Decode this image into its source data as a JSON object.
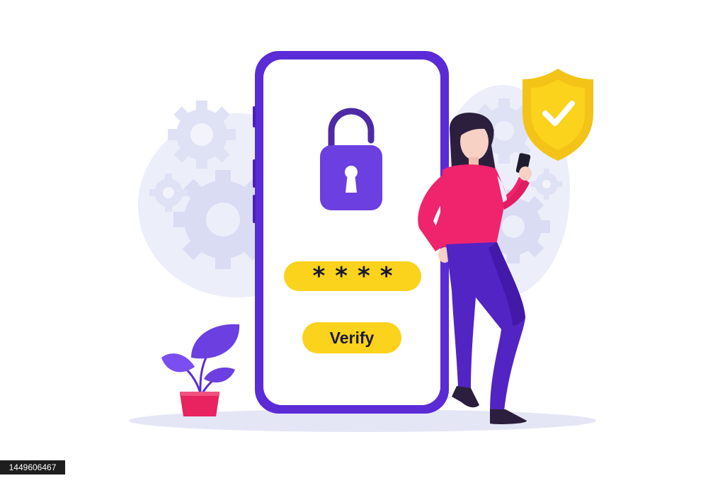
{
  "pin_field": {
    "value": "****"
  },
  "verify_button": {
    "label": "Verify"
  },
  "watermark": {
    "image_id": "1449606467"
  },
  "colors": {
    "accent_purple": "#6c3fe0",
    "phone_frame": "#5b2bd6",
    "accent_yellow": "#fbd21c",
    "shirt_pink": "#f0236d",
    "gear_lavender": "#e3e4f6"
  }
}
